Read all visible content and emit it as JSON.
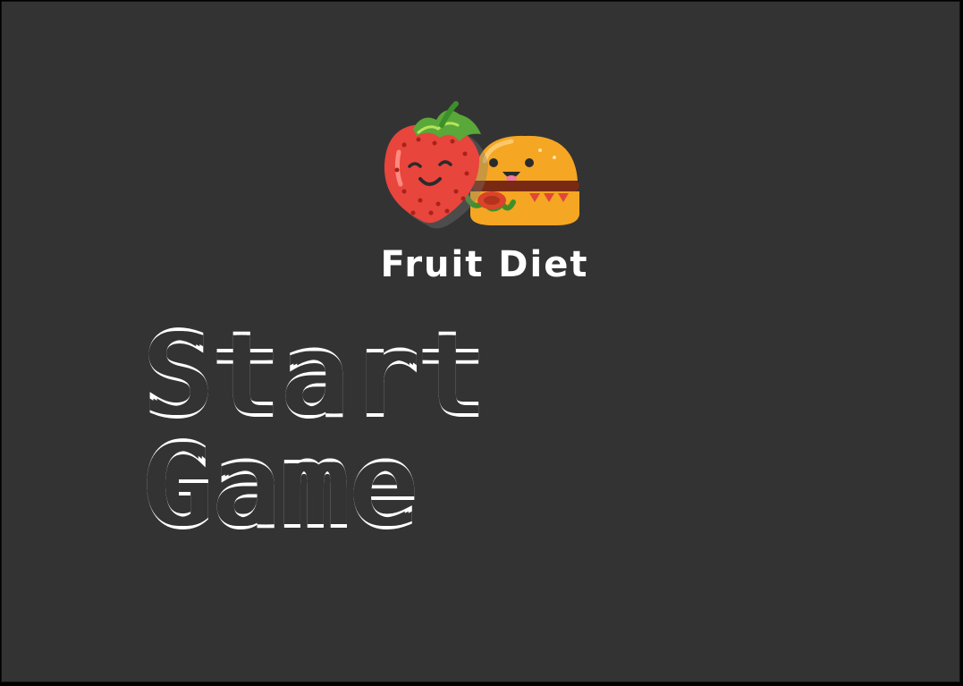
{
  "game": {
    "logo_title": "Fruit Diet",
    "start_label": "Start Game"
  },
  "icons": {
    "strawberry": "strawberry-icon",
    "burger": "burger-icon"
  },
  "colors": {
    "background": "#333333",
    "text": "#ffffff",
    "strawberry": "#e8453c",
    "leaf": "#5aa83a",
    "bun": "#f5a623",
    "patty": "#7a2a12"
  }
}
